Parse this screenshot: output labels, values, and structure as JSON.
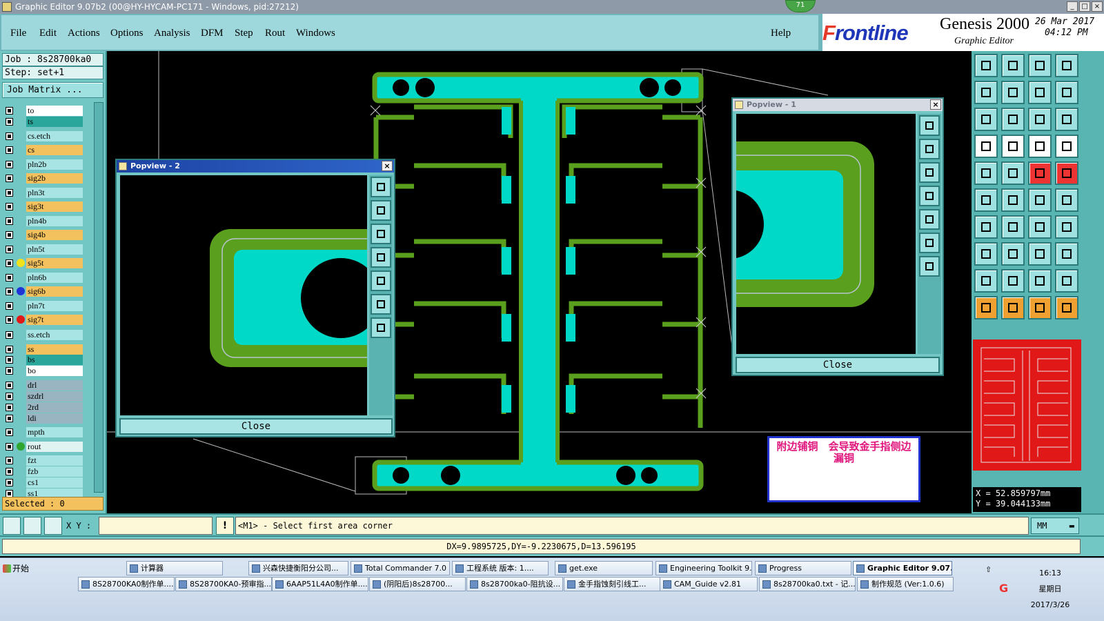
{
  "window": {
    "title": "Graphic Editor 9.07b2 (00@HY-HYCAM-PC171 - Windows, pid:27212)",
    "badge": "71"
  },
  "menu": {
    "items": [
      "File",
      "Edit",
      "Actions",
      "Options",
      "Analysis",
      "DFM",
      "Step",
      "Rout",
      "Windows"
    ],
    "help": "Help"
  },
  "brand": {
    "logo_prefix": "F",
    "logo_rest": "rontline",
    "product": "Genesis 2000",
    "subtitle": "Graphic Editor",
    "date": "26 Mar 2017",
    "time": "04:12 PM"
  },
  "job": {
    "job_label": "Job : 8s28700ka0",
    "step_label": "Step: set+1",
    "matrix_button": "Job Matrix ..."
  },
  "layers": [
    {
      "name": "to",
      "color": "#ffffff",
      "dot": ""
    },
    {
      "name": "ts",
      "color": "#2aa69a",
      "dot": ""
    },
    {
      "name": "cs.etch",
      "color": "#a9e4e4",
      "dot": ""
    },
    {
      "name": "cs",
      "color": "#f3c25f",
      "dot": ""
    },
    {
      "name": "pln2b",
      "color": "#a9e4e4",
      "dot": ""
    },
    {
      "name": "sig2b",
      "color": "#f3c25f",
      "dot": ""
    },
    {
      "name": "pln3t",
      "color": "#a9e4e4",
      "dot": ""
    },
    {
      "name": "sig3t",
      "color": "#f3c25f",
      "dot": ""
    },
    {
      "name": "pln4b",
      "color": "#a9e4e4",
      "dot": ""
    },
    {
      "name": "sig4b",
      "color": "#f3c25f",
      "dot": ""
    },
    {
      "name": "pln5t",
      "color": "#a9e4e4",
      "dot": ""
    },
    {
      "name": "sig5t",
      "color": "#f3c25f",
      "dot": "#f2e11d"
    },
    {
      "name": "pln6b",
      "color": "#a9e4e4",
      "dot": ""
    },
    {
      "name": "sig6b",
      "color": "#f3c25f",
      "dot": "#1f33d6"
    },
    {
      "name": "pln7t",
      "color": "#a9e4e4",
      "dot": ""
    },
    {
      "name": "sig7t",
      "color": "#f3c25f",
      "dot": "#e01818"
    },
    {
      "name": "ss.etch",
      "color": "#a9e4e4",
      "dot": ""
    },
    {
      "name": "ss",
      "color": "#f3c25f",
      "dot": ""
    },
    {
      "name": "bs",
      "color": "#2aa69a",
      "dot": ""
    },
    {
      "name": "bo",
      "color": "#ffffff",
      "dot": ""
    },
    {
      "name": "drl",
      "color": "#98b5c1",
      "dot": ""
    },
    {
      "name": "szdrl",
      "color": "#98b5c1",
      "dot": ""
    },
    {
      "name": "2rd",
      "color": "#98b5c1",
      "dot": ""
    },
    {
      "name": "ldi",
      "color": "#98b5c1",
      "dot": ""
    },
    {
      "name": "mpth",
      "color": "#a9e4e4",
      "dot": ""
    },
    {
      "name": "rout",
      "color": "#dff3f3",
      "dot": "#2fa62f"
    },
    {
      "name": "fzt",
      "color": "#a9e4e4",
      "dot": ""
    },
    {
      "name": "fzb",
      "color": "#a9e4e4",
      "dot": ""
    },
    {
      "name": "cs1",
      "color": "#a9e4e4",
      "dot": ""
    },
    {
      "name": "ss1",
      "color": "#a9e4e4",
      "dot": ""
    }
  ],
  "selected": "Selected : 0",
  "popview1": {
    "title": "Popview - 1",
    "close": "Close"
  },
  "popview2": {
    "title": "Popview - 2",
    "close": "Close"
  },
  "annotation": "附边铺铜　会导致金手指侧边漏铜",
  "coords": {
    "x": "X  =  52.859797mm",
    "y": "Y  =  39.044133mm"
  },
  "command": {
    "xy_label": "X Y :",
    "xy_value": "",
    "message": "<M1> - Select first area corner",
    "unit": "MM"
  },
  "measure": "DX=9.9895725,DY=-9.2230675,D=13.596195",
  "taskbar": {
    "start": "开始",
    "row1": [
      "计算器",
      "兴森快捷衡阳分公司...",
      "Total Commander 7.0 ...",
      "工程系统   版本: 1....",
      "get.exe",
      "Engineering Toolkit 9....",
      "Progress",
      "Graphic Editor 9.07..."
    ],
    "row2": [
      "8S28700KA0制作单....",
      "8S28700KA0-预审指...",
      "6AAP51L4A0制作单....",
      "(阴阳后)8s28700...",
      "8s28700ka0-阻抗设...",
      "金手指蚀刻引线工...",
      "CAM_Guide v2.81",
      "8s28700ka0.txt - 记...",
      "制作规范 (Ver:1.0.6)"
    ],
    "time": "16:13",
    "weekday": "星期日",
    "date": "2017/3/26"
  },
  "colors": {
    "copper": "#00d8c8",
    "outline": "#5aa01e",
    "panel": "#72c7c4",
    "minimap": "#e01818"
  }
}
